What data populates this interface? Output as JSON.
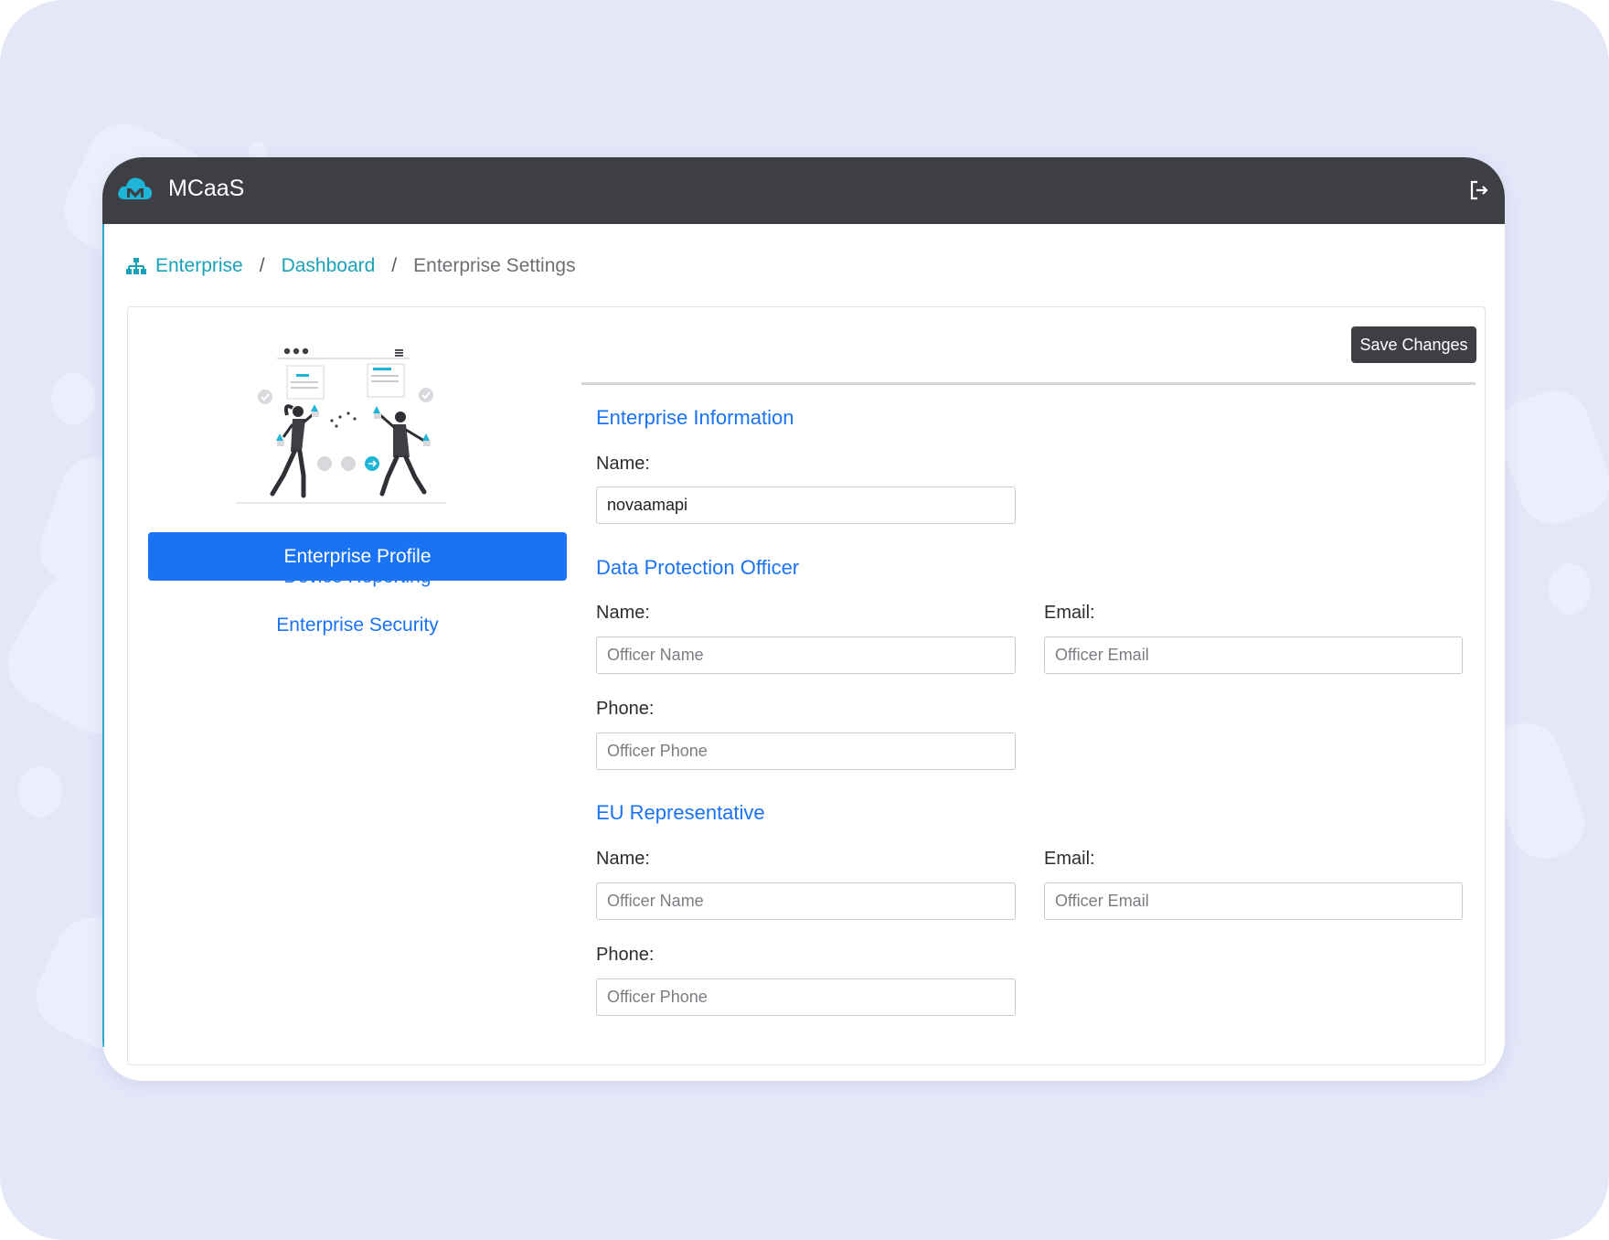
{
  "app": {
    "title": "MCaaS"
  },
  "header": {
    "logo_icon": "cloud-m-logo-icon",
    "logout_icon": "logout-icon"
  },
  "breadcrumb": {
    "icon": "sitemap-icon",
    "items": [
      "Enterprise",
      "Dashboard",
      "Enterprise Settings"
    ],
    "separator": "/"
  },
  "sidebar": {
    "illustration": "team-collaboration-illustration",
    "items": [
      {
        "label": "Enterprise Profile",
        "active": true
      },
      {
        "label": "Device Reporting",
        "active": false
      },
      {
        "label": "Enterprise Security",
        "active": false
      }
    ]
  },
  "actions": {
    "save_label": "Save Changes"
  },
  "sections": {
    "enterprise_info": {
      "title": "Enterprise Information",
      "name_label": "Name:",
      "name_value": "novaamapi"
    },
    "dpo": {
      "title": "Data Protection Officer",
      "name_label": "Name:",
      "name_placeholder": "Officer Name",
      "email_label": "Email:",
      "email_placeholder": "Officer Email",
      "phone_label": "Phone:",
      "phone_placeholder": "Officer Phone"
    },
    "eu_rep": {
      "title": "EU Representative",
      "name_label": "Name:",
      "name_placeholder": "Officer Name",
      "email_label": "Email:",
      "email_placeholder": "Officer Email",
      "phone_label": "Phone:",
      "phone_placeholder": "Officer Phone"
    }
  },
  "colors": {
    "background": "#e4e7f8",
    "header": "#3e3f45",
    "primary": "#1a73f5",
    "breadcrumb_link": "#17a2b8",
    "logo": "#1fb5d6"
  }
}
